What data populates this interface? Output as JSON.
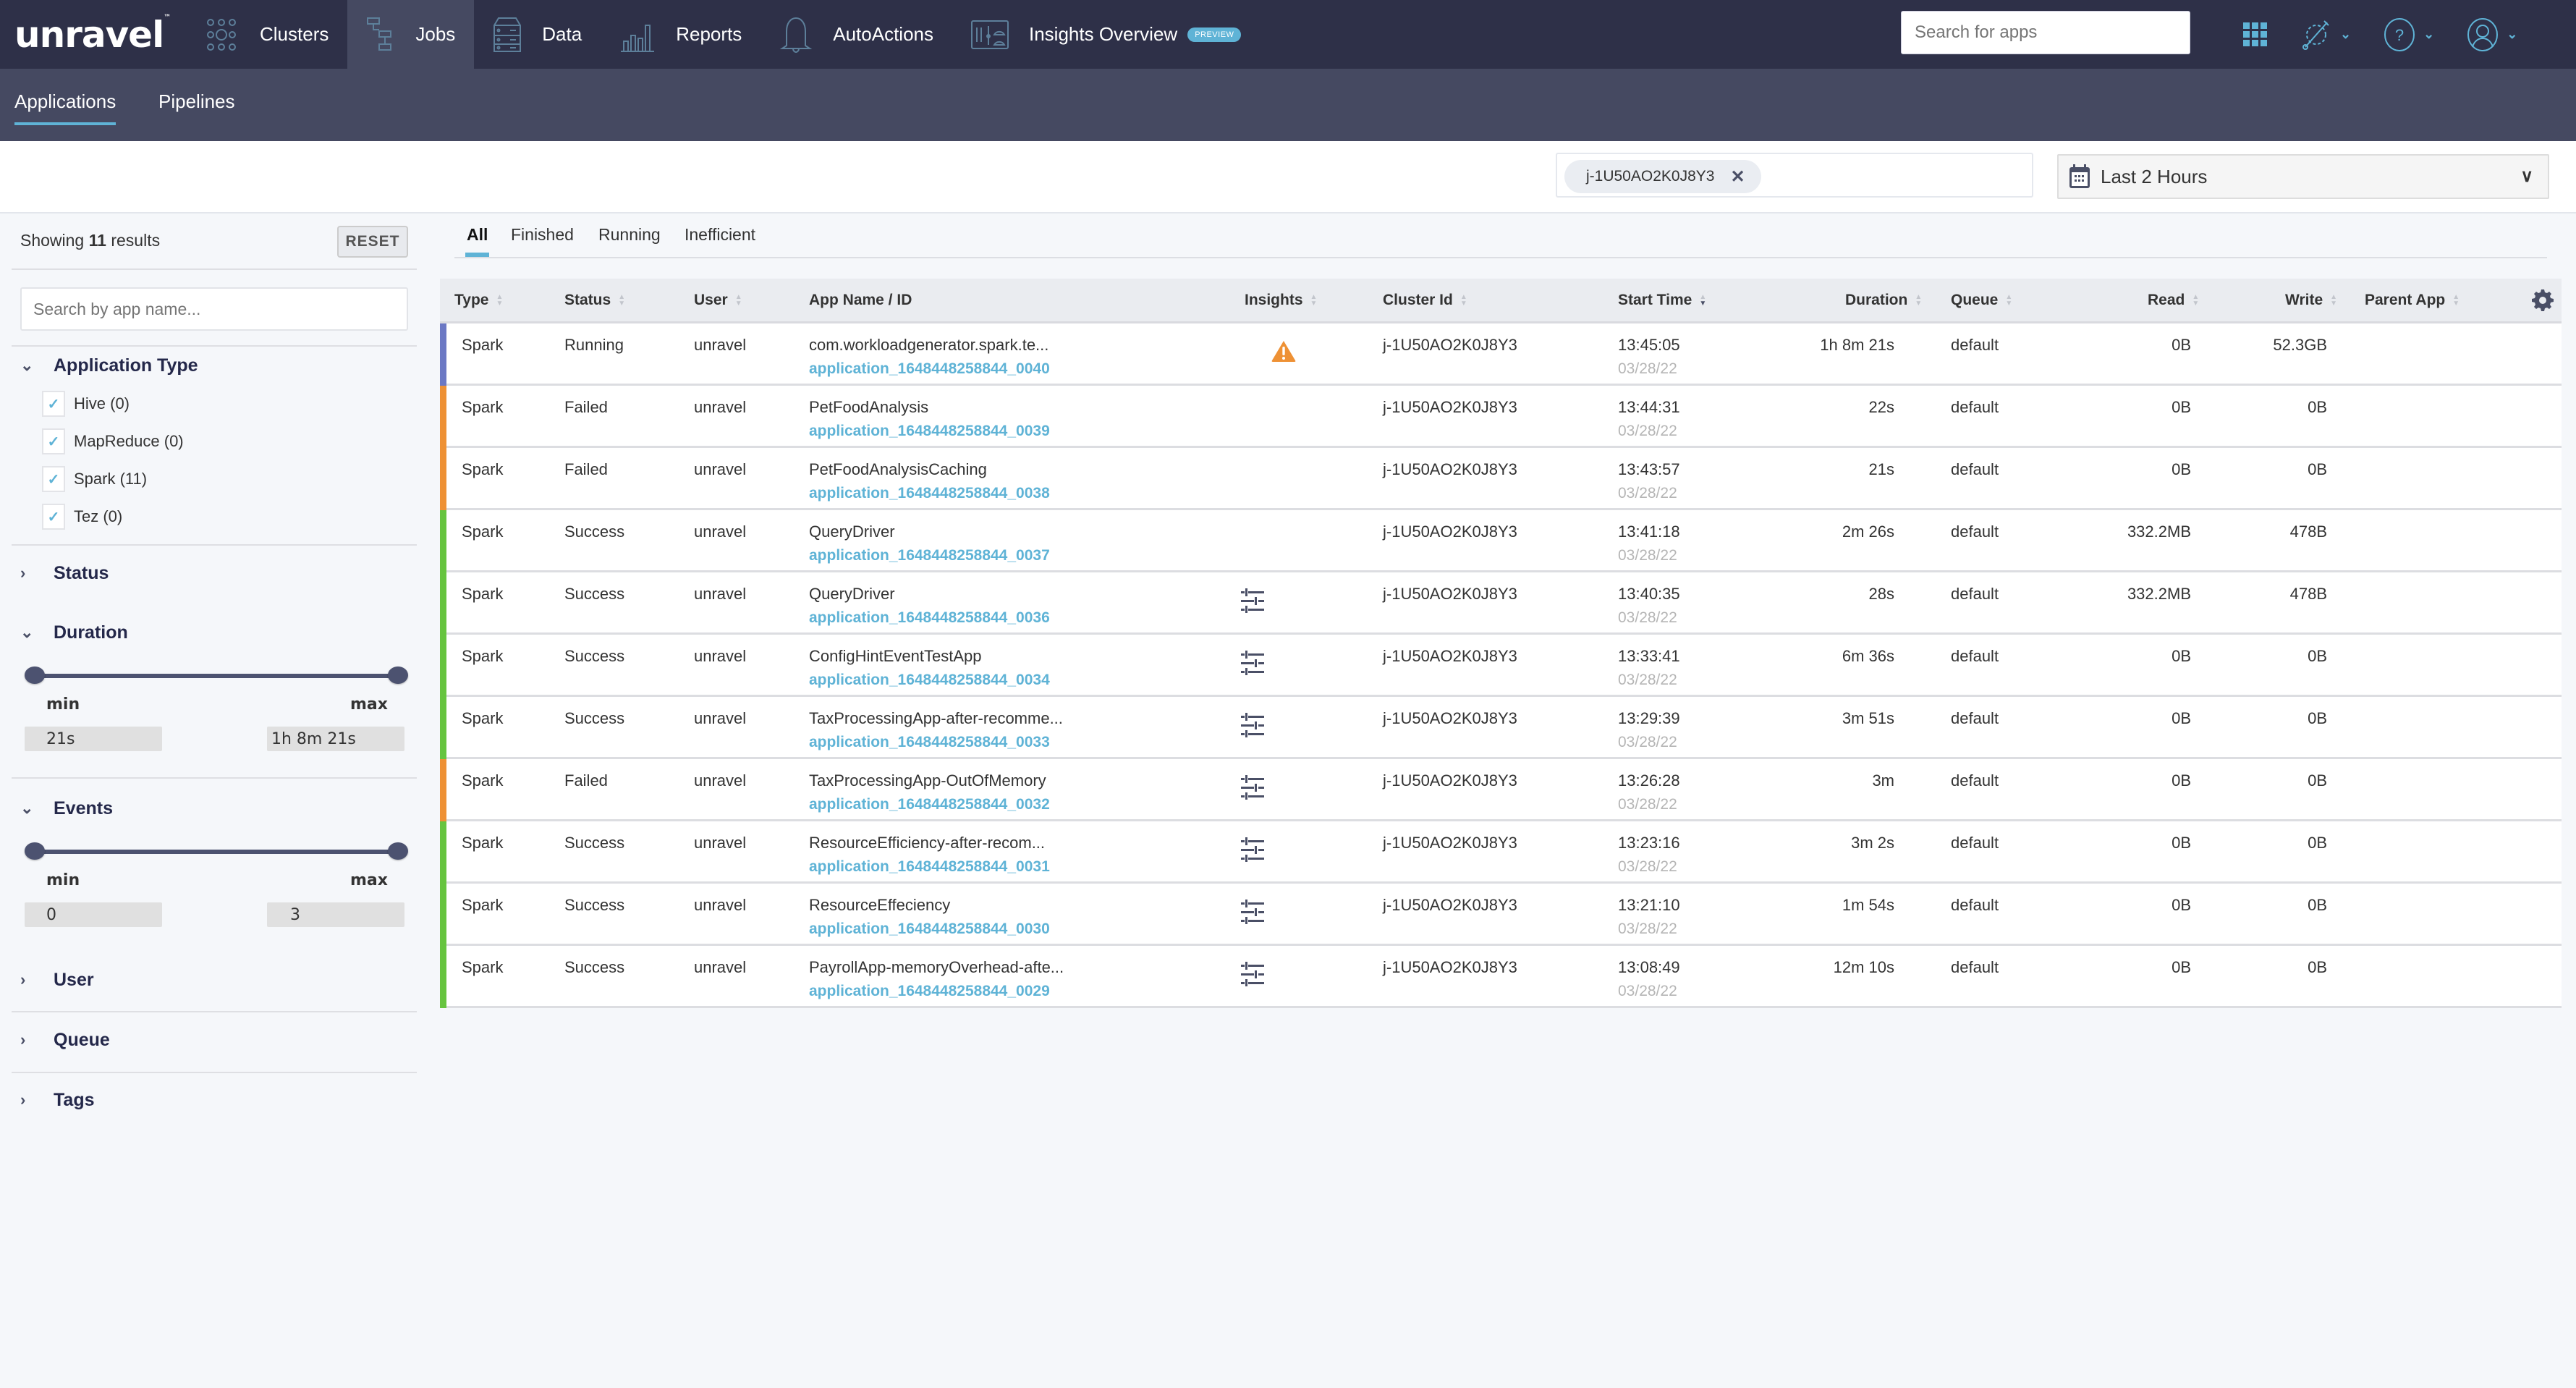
{
  "app": {
    "logo": "unravel",
    "logo_tm": "™"
  },
  "topnav": {
    "items": [
      {
        "label": "Clusters",
        "icon": "clusters-icon"
      },
      {
        "label": "Jobs",
        "icon": "jobs-icon",
        "active": true
      },
      {
        "label": "Data",
        "icon": "data-icon"
      },
      {
        "label": "Reports",
        "icon": "reports-icon"
      },
      {
        "label": "AutoActions",
        "icon": "bell-icon"
      },
      {
        "label": "Insights Overview",
        "icon": "insights-icon",
        "badge": "PREVIEW"
      }
    ],
    "search_placeholder": "Search for apps",
    "icons": [
      "apps-grid-icon",
      "settings-wrench-icon",
      "help-icon",
      "user-icon"
    ]
  },
  "subnav": {
    "tabs": [
      {
        "label": "Applications",
        "active": true
      },
      {
        "label": "Pipelines"
      }
    ]
  },
  "filterbar": {
    "cluster_chip": "j-1U50AO2K0J8Y3",
    "date_range": "Last 2 Hours"
  },
  "sidebar": {
    "showing_prefix": "Showing",
    "showing_count": "11",
    "showing_suffix": "results",
    "reset_label": "RESET",
    "search_placeholder": "Search by app name...",
    "app_type": {
      "title": "Application Type",
      "options": [
        {
          "label": "Hive (0)",
          "checked": true
        },
        {
          "label": "MapReduce (0)",
          "checked": true
        },
        {
          "label": "Spark (11)",
          "checked": true
        },
        {
          "label": "Tez (0)",
          "checked": true
        }
      ]
    },
    "status_title": "Status",
    "duration": {
      "title": "Duration",
      "min_label": "min",
      "max_label": "max",
      "min": "21s",
      "max": "1h 8m 21s"
    },
    "events": {
      "title": "Events",
      "min_label": "min",
      "max_label": "max",
      "min": "0",
      "max": "3"
    },
    "user_title": "User",
    "queue_title": "Queue",
    "tags_title": "Tags"
  },
  "main": {
    "tabs": [
      {
        "label": "All",
        "active": true
      },
      {
        "label": "Finished"
      },
      {
        "label": "Running"
      },
      {
        "label": "Inefficient"
      }
    ],
    "columns": [
      "Type",
      "Status",
      "User",
      "App Name / ID",
      "Insights",
      "Cluster Id",
      "Start Time",
      "Duration",
      "Queue",
      "Read",
      "Write",
      "Parent App"
    ],
    "status_colors": {
      "Running": "#6b78c4",
      "Failed": "#ee9135",
      "Success": "#66c43f"
    },
    "rows": [
      {
        "type": "Spark",
        "status": "Running",
        "user": "unravel",
        "name": "com.workloadgenerator.spark.te...",
        "id": "application_1648448258844_0040",
        "insight": "warning",
        "cluster": "j-1U50AO2K0J8Y3",
        "time": "13:45:05",
        "date": "03/28/22",
        "duration": "1h 8m 21s",
        "queue": "default",
        "read": "0B",
        "write": "52.3GB",
        "parent": ""
      },
      {
        "type": "Spark",
        "status": "Failed",
        "user": "unravel",
        "name": "PetFoodAnalysis",
        "id": "application_1648448258844_0039",
        "insight": "",
        "cluster": "j-1U50AO2K0J8Y3",
        "time": "13:44:31",
        "date": "03/28/22",
        "duration": "22s",
        "queue": "default",
        "read": "0B",
        "write": "0B",
        "parent": ""
      },
      {
        "type": "Spark",
        "status": "Failed",
        "user": "unravel",
        "name": "PetFoodAnalysisCaching",
        "id": "application_1648448258844_0038",
        "insight": "",
        "cluster": "j-1U50AO2K0J8Y3",
        "time": "13:43:57",
        "date": "03/28/22",
        "duration": "21s",
        "queue": "default",
        "read": "0B",
        "write": "0B",
        "parent": ""
      },
      {
        "type": "Spark",
        "status": "Success",
        "user": "unravel",
        "name": "QueryDriver",
        "id": "application_1648448258844_0037",
        "insight": "",
        "cluster": "j-1U50AO2K0J8Y3",
        "time": "13:41:18",
        "date": "03/28/22",
        "duration": "2m 26s",
        "queue": "default",
        "read": "332.2MB",
        "write": "478B",
        "parent": ""
      },
      {
        "type": "Spark",
        "status": "Success",
        "user": "unravel",
        "name": "QueryDriver",
        "id": "application_1648448258844_0036",
        "insight": "tuning",
        "cluster": "j-1U50AO2K0J8Y3",
        "time": "13:40:35",
        "date": "03/28/22",
        "duration": "28s",
        "queue": "default",
        "read": "332.2MB",
        "write": "478B",
        "parent": ""
      },
      {
        "type": "Spark",
        "status": "Success",
        "user": "unravel",
        "name": "ConfigHintEventTestApp",
        "id": "application_1648448258844_0034",
        "insight": "tuning",
        "cluster": "j-1U50AO2K0J8Y3",
        "time": "13:33:41",
        "date": "03/28/22",
        "duration": "6m 36s",
        "queue": "default",
        "read": "0B",
        "write": "0B",
        "parent": ""
      },
      {
        "type": "Spark",
        "status": "Success",
        "user": "unravel",
        "name": "TaxProcessingApp-after-recomme...",
        "id": "application_1648448258844_0033",
        "insight": "tuning",
        "cluster": "j-1U50AO2K0J8Y3",
        "time": "13:29:39",
        "date": "03/28/22",
        "duration": "3m 51s",
        "queue": "default",
        "read": "0B",
        "write": "0B",
        "parent": ""
      },
      {
        "type": "Spark",
        "status": "Failed",
        "user": "unravel",
        "name": "TaxProcessingApp-OutOfMemory",
        "id": "application_1648448258844_0032",
        "insight": "tuning",
        "cluster": "j-1U50AO2K0J8Y3",
        "time": "13:26:28",
        "date": "03/28/22",
        "duration": "3m",
        "queue": "default",
        "read": "0B",
        "write": "0B",
        "parent": ""
      },
      {
        "type": "Spark",
        "status": "Success",
        "user": "unravel",
        "name": "ResourceEfficiency-after-recom...",
        "id": "application_1648448258844_0031",
        "insight": "tuning",
        "cluster": "j-1U50AO2K0J8Y3",
        "time": "13:23:16",
        "date": "03/28/22",
        "duration": "3m 2s",
        "queue": "default",
        "read": "0B",
        "write": "0B",
        "parent": ""
      },
      {
        "type": "Spark",
        "status": "Success",
        "user": "unravel",
        "name": "ResourceEffeciency",
        "id": "application_1648448258844_0030",
        "insight": "tuning",
        "cluster": "j-1U50AO2K0J8Y3",
        "time": "13:21:10",
        "date": "03/28/22",
        "duration": "1m 54s",
        "queue": "default",
        "read": "0B",
        "write": "0B",
        "parent": ""
      },
      {
        "type": "Spark",
        "status": "Success",
        "user": "unravel",
        "name": "PayrollApp-memoryOverhead-afte...",
        "id": "application_1648448258844_0029",
        "insight": "tuning",
        "cluster": "j-1U50AO2K0J8Y3",
        "time": "13:08:49",
        "date": "03/28/22",
        "duration": "12m 10s",
        "queue": "default",
        "read": "0B",
        "write": "0B",
        "parent": ""
      }
    ]
  }
}
